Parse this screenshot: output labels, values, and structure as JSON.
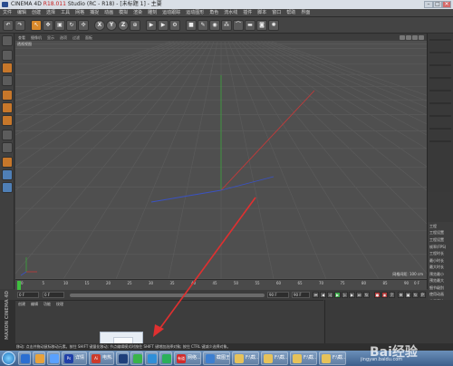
{
  "window": {
    "title_prefix": "CINEMA 4D ",
    "title_version": "R18.011",
    "title_suffix": " Studio (RC - R18) - [未标题 1] - 主要",
    "min_symbol": "–",
    "max_symbol": "□",
    "close_symbol": "✕"
  },
  "menu": [
    "文件",
    "编辑",
    "创建",
    "选择",
    "工具",
    "网格",
    "捕捉",
    "动画",
    "模拟",
    "渲染",
    "雕刻",
    "运动跟踪",
    "运动图形",
    "角色",
    "流水线",
    "插件",
    "脚本",
    "窗口",
    "帮助",
    "界面"
  ],
  "toolbar": {
    "axis_x": "X",
    "axis_y": "Y",
    "axis_z": "Z"
  },
  "viewport": {
    "menu": [
      "查看",
      "摄像机",
      "显示",
      "选项",
      "过滤",
      "面板"
    ],
    "label": "透视视图",
    "grid_size": "网格间距: 100 cm",
    "colors": {
      "background": "#4f4f4f",
      "grid": "#5b5b5b",
      "x_axis": "#c23a3a",
      "y_axis": "#3aa63a",
      "z_axis": "#3a52c2",
      "arrow": "#e03030"
    }
  },
  "right_panel": {
    "tabs": [
      "文件",
      "编辑",
      "查看",
      "对象",
      "标签",
      "书签"
    ],
    "attr_header": "工程",
    "attr_sub": "工程设置",
    "lines": [
      "工程设置",
      "帧率(FPS)",
      "工程时长",
      "最小时长",
      "最大时长",
      "预览最小",
      "预览最大",
      "细节级别",
      "使用动画",
      "使用表达",
      "使用生成",
      "使用变形",
      "使用运动",
      "默认对象"
    ]
  },
  "timeline": {
    "ticks": [
      "0",
      "5",
      "10",
      "15",
      "20",
      "25",
      "30",
      "35",
      "40",
      "45",
      "50",
      "55",
      "60",
      "65",
      "70",
      "75",
      "80",
      "85",
      "90"
    ],
    "end_frame": "0 F"
  },
  "transport": {
    "start_field": "0 F",
    "min_field": "0 F",
    "max_field": "90 F",
    "end_field": "90 F"
  },
  "materials": {
    "menu": [
      "创建",
      "编辑",
      "功能",
      "纹理"
    ]
  },
  "logo": "MAXON CINEMA 4D",
  "drag_icon": {
    "glyph": "3"
  },
  "status": "移动: 点击并拖动鼠标移动元素。按住 SHIFT 键量化移动; 节点编辑模式时按住 SHIFT 键增加选择对象; 按住 CTRL 键减少选择对象。",
  "taskbar": {
    "items": [
      {
        "label": "",
        "color": "#2b6fd1"
      },
      {
        "label": "",
        "color": "#e8a23a"
      },
      {
        "label": "",
        "color": "#5aa1ff"
      },
      {
        "label": "详情",
        "color": "#1f3fa8"
      },
      {
        "label": "电热...",
        "color": "#cc3b2b"
      },
      {
        "label": "",
        "color": "#1e3f7a"
      },
      {
        "label": "",
        "color": "#39b44a"
      },
      {
        "label": "",
        "color": "#2f8fd8"
      },
      {
        "label": "",
        "color": "#2ab05a"
      },
      {
        "label": "网络...",
        "color": "#d12c2c"
      },
      {
        "label": "截图王",
        "color": "#3d7fd0"
      },
      {
        "label": "F:\\截...",
        "color": "#e6c25a"
      },
      {
        "label": "F:\\截...",
        "color": "#e6c25a"
      },
      {
        "label": "F:\\截...",
        "color": "#e6c25a"
      },
      {
        "label": "F:\\截...",
        "color": "#e6c25a"
      }
    ],
    "ps_label": "Ps",
    "ai_label": "Ai",
    "youdao_label": "有道"
  },
  "watermark": {
    "text": "Bai经验",
    "url": "jingyan.baidu.com"
  }
}
